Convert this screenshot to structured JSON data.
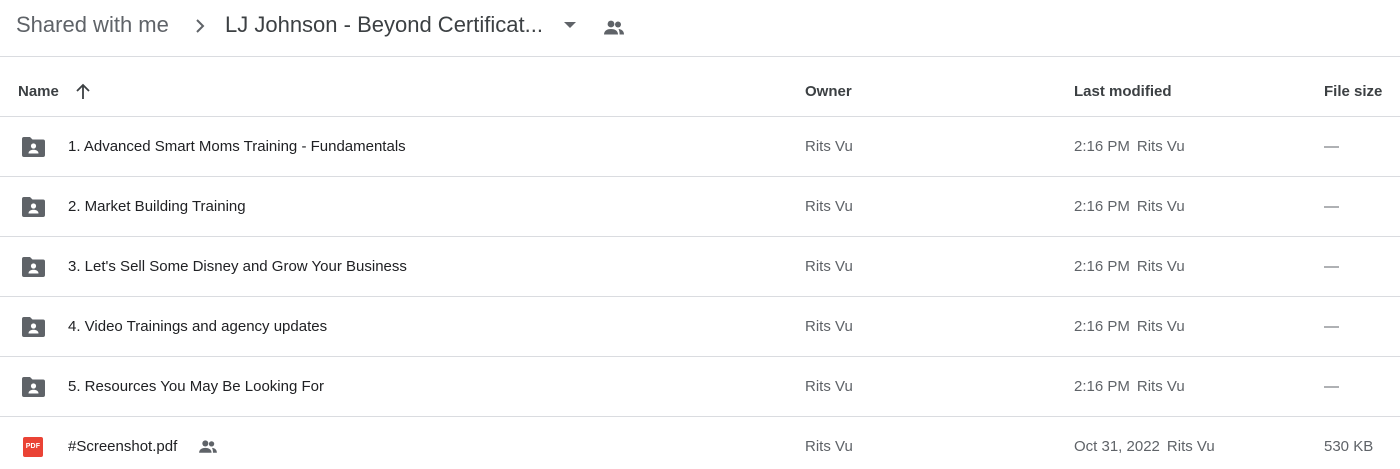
{
  "breadcrumb": {
    "root": "Shared with me",
    "current": "LJ Johnson - Beyond Certificat..."
  },
  "columns": {
    "name": "Name",
    "owner": "Owner",
    "last_modified": "Last modified",
    "file_size": "File size"
  },
  "rows": [
    {
      "type": "shared-folder",
      "name": "1. Advanced Smart Moms Training - Fundamentals",
      "owner": "Rits Vu",
      "modified": "2:16 PM",
      "modified_by": "Rits Vu",
      "size": "—"
    },
    {
      "type": "shared-folder",
      "name": "2. Market Building Training",
      "owner": "Rits Vu",
      "modified": "2:16 PM",
      "modified_by": "Rits Vu",
      "size": "—"
    },
    {
      "type": "shared-folder",
      "name": "3. Let's Sell Some Disney and Grow Your Business",
      "owner": "Rits Vu",
      "modified": "2:16 PM",
      "modified_by": "Rits Vu",
      "size": "—"
    },
    {
      "type": "shared-folder",
      "name": "4. Video Trainings and agency updates",
      "owner": "Rits Vu",
      "modified": "2:16 PM",
      "modified_by": "Rits Vu",
      "size": "—"
    },
    {
      "type": "shared-folder",
      "name": "5. Resources You May Be Looking For",
      "owner": "Rits Vu",
      "modified": "2:16 PM",
      "modified_by": "Rits Vu",
      "size": "—"
    },
    {
      "type": "pdf",
      "icon_text": "PDF",
      "name": "#Screenshot.pdf",
      "owner": "Rits Vu",
      "modified": "Oct 31, 2022",
      "modified_by": "Rits Vu",
      "size": "530 KB"
    }
  ],
  "colors": {
    "icon_gray": "#5f6368",
    "pdf_red": "#ea4335",
    "divider": "#dadce0"
  }
}
